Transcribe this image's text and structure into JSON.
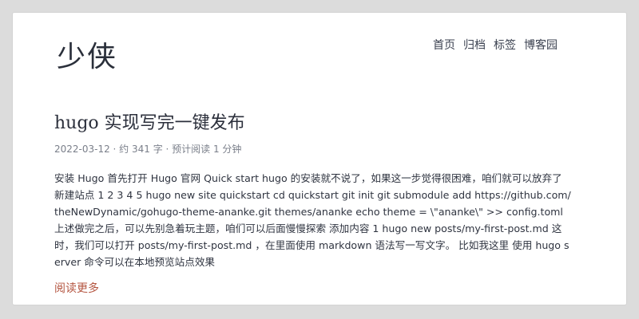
{
  "site": {
    "title": "少侠"
  },
  "nav": {
    "items": [
      {
        "label": "首页"
      },
      {
        "label": "归档"
      },
      {
        "label": "标签"
      },
      {
        "label": "博客园"
      }
    ]
  },
  "post": {
    "title": "hugo 实现写完一键发布",
    "meta": "2022-03-12 · 约 341 字 · 预计阅读 1 分钟",
    "excerpt": "安装 Hugo 首先打开 Hugo 官网 Quick start hugo 的安装就不说了，如果这一步觉得很困难，咱们就可以放弃了 新建站点 1 2 3 4 5 hugo new site quickstart cd quickstart git init git submodule add https://github.com/theNewDynamic/gohugo-theme-ananke.git themes/ananke echo theme = \\\"ananke\\\" >> config.toml 上述做完之后，可以先别急着玩主题，咱们可以后面慢慢探索 添加内容 1 hugo new posts/my-first-post.md 这时，我们可以打开 posts/my-first-post.md ，在里面使用 markdown 语法写一写文字。 比如我这里 使用 hugo server 命令可以在本地预览站点效果",
    "read_more": "阅读更多"
  },
  "colors": {
    "background": "#dcdcdc",
    "card": "#ffffff",
    "text": "#2f3440",
    "accent": "#b45540",
    "muted": "#7a7f8a"
  }
}
